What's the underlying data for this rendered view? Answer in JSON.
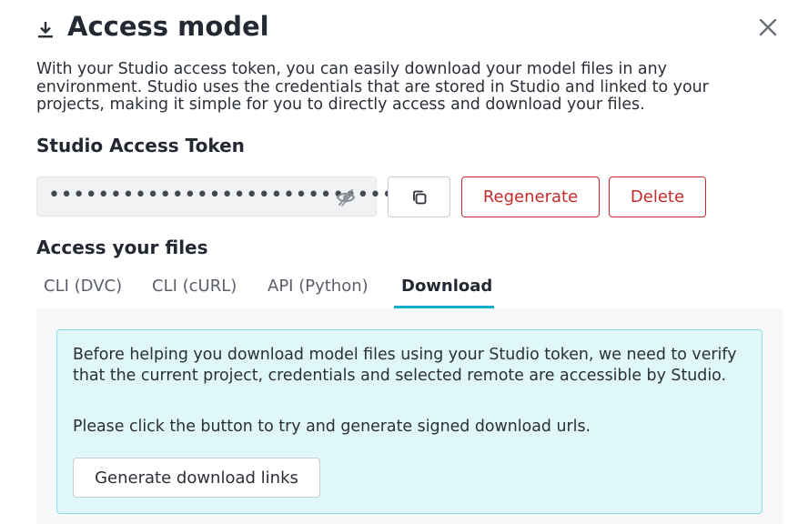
{
  "dialog": {
    "title": "Access model",
    "title_icon": "download-icon",
    "close_icon": "close-icon",
    "description": "With your Studio access token, you can easily download your model files in any environment. Studio uses the credentials that are stored in Studio and linked to your projects, making it simple for you to directly access and download your files."
  },
  "token": {
    "section_title": "Studio Access Token",
    "masked_value": "••••••••••••••••••••••••••••",
    "visibility_icon": "eye-off-icon",
    "copy_icon": "copy-icon",
    "regenerate_label": "Regenerate",
    "delete_label": "Delete",
    "danger_color": "#c42b2b"
  },
  "files": {
    "section_title": "Access your files",
    "tabs": [
      {
        "label": "CLI (DVC)",
        "active": false
      },
      {
        "label": "CLI (cURL)",
        "active": false
      },
      {
        "label": "API (Python)",
        "active": false
      },
      {
        "label": "Download",
        "active": true
      }
    ],
    "accent_color": "#13adc7",
    "download": {
      "info_text": "Before helping you download model files using your Studio token, we need to verify that the current project, credentials and selected remote are accessible by Studio.",
      "instruction": "Please click the button to try and generate signed download urls.",
      "button_label": "Generate download links"
    }
  }
}
